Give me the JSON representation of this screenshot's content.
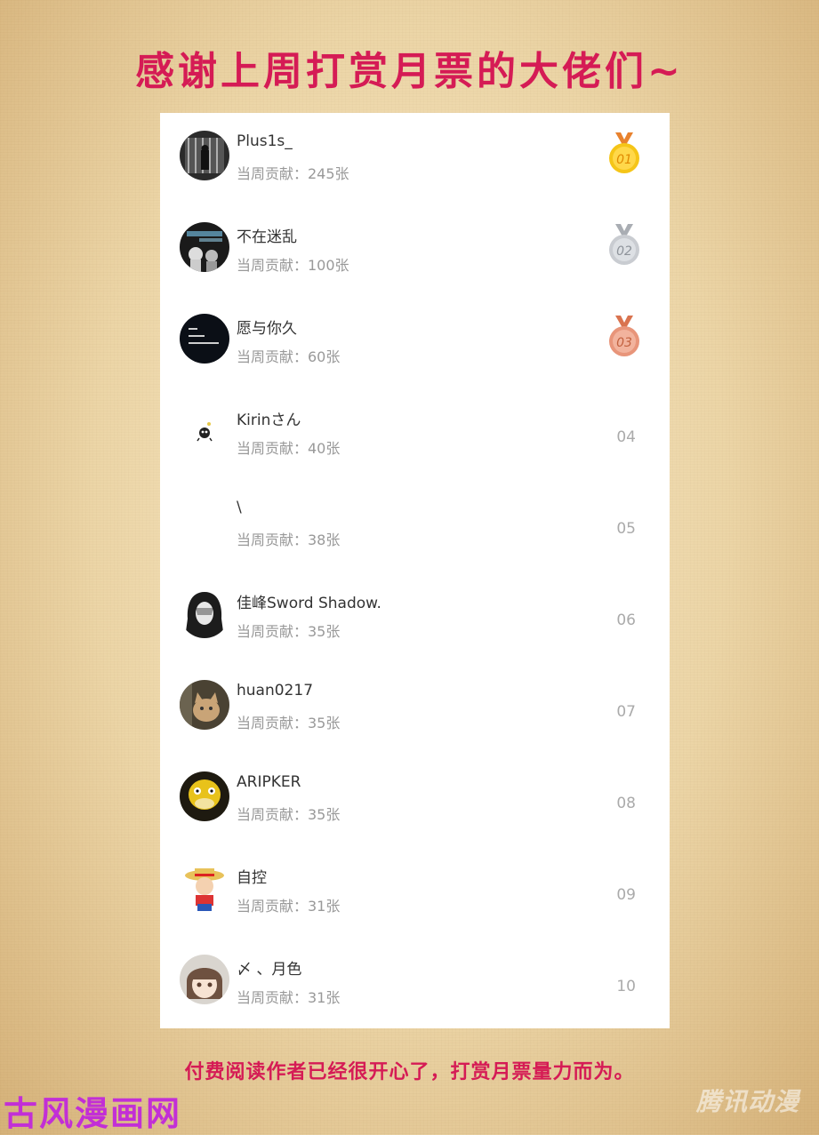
{
  "title": "感谢上周打赏月票的大佬们~",
  "footer": "付费阅读作者已经很开心了，打赏月票量力而为。",
  "watermark_left": "古风漫画网",
  "watermark_right": "腾讯动漫",
  "entries": [
    {
      "rank": "01",
      "name": "Plus1s_",
      "contribution": "当周贡献：245张",
      "medal": "gold",
      "avatar": "dark-photo-avatar"
    },
    {
      "rank": "02",
      "name": "不在迷乱",
      "contribution": "当周贡献：100张",
      "medal": "silver",
      "avatar": "dark-text-avatar"
    },
    {
      "rank": "03",
      "name": "愿与你久",
      "contribution": "当周贡献：60张",
      "medal": "bronze",
      "avatar": "black-text-avatar"
    },
    {
      "rank": "04",
      "name": "Kirinさん",
      "contribution": "当周贡献：40张",
      "medal": "",
      "avatar": "tiny-creature-avatar"
    },
    {
      "rank": "05",
      "name": "\\",
      "contribution": "当周贡献：38张",
      "medal": "",
      "avatar": "blank-avatar"
    },
    {
      "rank": "06",
      "name": "佳峰Sword Shadow.",
      "contribution": "当周贡献：35张",
      "medal": "",
      "avatar": "hooded-figure-avatar"
    },
    {
      "rank": "07",
      "name": "huan0217",
      "contribution": "当周贡献：35张",
      "medal": "",
      "avatar": "cat-avatar"
    },
    {
      "rank": "08",
      "name": "ARIPKER",
      "contribution": "当周贡献：35张",
      "medal": "",
      "avatar": "yellow-duck-avatar"
    },
    {
      "rank": "09",
      "name": "自控",
      "contribution": "当周贡献：31张",
      "medal": "",
      "avatar": "straw-hat-cartoon-avatar"
    },
    {
      "rank": "10",
      "name": "〆 、月色",
      "contribution": "当周贡献：31张",
      "medal": "",
      "avatar": "anime-girl-avatar"
    }
  ],
  "colors": {
    "accent": "#d51b55",
    "gold": "#f5c518",
    "silver": "#c9ccd1",
    "bronze": "#e8957a"
  }
}
